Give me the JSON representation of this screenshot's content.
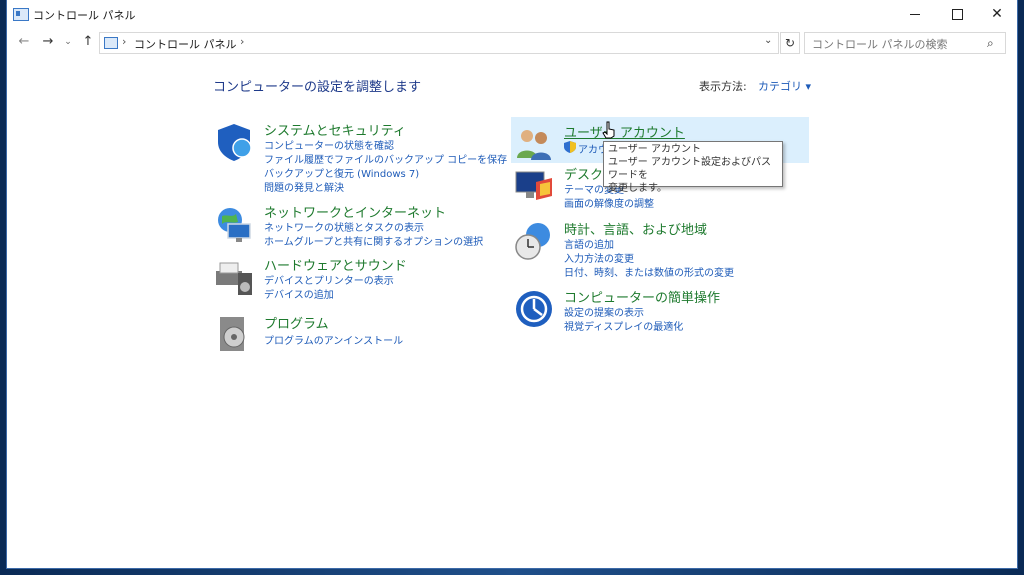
{
  "window": {
    "title": "コントロール パネル",
    "minimize": "—",
    "maximize": "□",
    "close": "✕"
  },
  "nav": {
    "back": "←",
    "forward": "→",
    "history": "⌄",
    "up": "↑",
    "address": "コントロール パネル",
    "address_sep1": "›",
    "address_sep2": "›",
    "dropdown": "⌄",
    "refresh": "↻",
    "search_placeholder": "コントロール パネルの検索",
    "search_icon": "⌕"
  },
  "main": {
    "heading": "コンピューターの設定を調整します",
    "view_by_label": "表示方法:",
    "view_by_value": "カテゴリ ▾"
  },
  "categories_left": [
    {
      "title": "システムとセキュリティ",
      "icon": "shield-icon",
      "links": [
        "コンピューターの状態を確認",
        "ファイル履歴でファイルのバックアップ コピーを保存",
        "バックアップと復元 (Windows 7)",
        "問題の発見と解決"
      ]
    },
    {
      "title": "ネットワークとインターネット",
      "icon": "network-globe-icon",
      "links": [
        "ネットワークの状態とタスクの表示",
        "ホームグループと共有に関するオプションの選択"
      ]
    },
    {
      "title": "ハードウェアとサウンド",
      "icon": "printer-speaker-icon",
      "links": [
        "デバイスとプリンターの表示",
        "デバイスの追加"
      ]
    },
    {
      "title": "プログラム",
      "icon": "program-disc-icon",
      "links": [
        "プログラムのアンインストール"
      ]
    }
  ],
  "categories_right": [
    {
      "title": "ユーザー アカウント",
      "icon": "users-icon",
      "links": [
        "アカウント"
      ]
    },
    {
      "title": "デスクトップ",
      "icon": "desktop-icon",
      "links": [
        "テーマの変更",
        "画面の解像度の調整"
      ]
    },
    {
      "title": "時計、言語、および地域",
      "icon": "clock-globe-icon",
      "links": [
        "言語の追加",
        "入力方法の変更",
        "日付、時刻、または数値の形式の変更"
      ]
    },
    {
      "title": "コンピューターの簡単操作",
      "icon": "ease-of-access-icon",
      "links": [
        "設定の提案の表示",
        "視覚ディスプレイの最適化"
      ]
    }
  ],
  "tooltip": {
    "line1": "ユーザー アカウント",
    "line2": "ユーザー アカウント設定およびパスワードを",
    "line3": "変更します。"
  },
  "colors": {
    "title_green": "#1e7a2e",
    "link_blue": "#1e5bb8",
    "highlight": "#dbeffd"
  }
}
